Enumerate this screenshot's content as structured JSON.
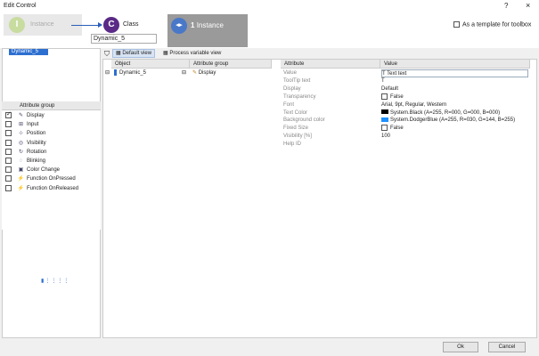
{
  "window": {
    "title": "Edit Control",
    "help": "?",
    "close": "×"
  },
  "wizard": {
    "step1_letter": "I",
    "step1_label": "Instance",
    "step2_letter": "C",
    "step2_label": "Class",
    "name_value": "Dynamic_5",
    "step3_count": "1",
    "step3_label": "Instance",
    "template_label": "As a template for toolbox"
  },
  "tree": {
    "selected": "Dynamic_5"
  },
  "attribute_groups": {
    "header": "Attribute group",
    "items": [
      {
        "label": "Display",
        "checked": true,
        "icon": "pencil-icon"
      },
      {
        "label": "Input",
        "checked": false,
        "icon": "input-icon"
      },
      {
        "label": "Position",
        "checked": false,
        "icon": "position-icon"
      },
      {
        "label": "Visibility",
        "checked": false,
        "icon": "eye-icon"
      },
      {
        "label": "Rotation",
        "checked": false,
        "icon": "rotation-icon"
      },
      {
        "label": "Blinking",
        "checked": false,
        "icon": "blink-icon"
      },
      {
        "label": "Color Change",
        "checked": false,
        "icon": "color-icon"
      },
      {
        "label": "Function OnPressed",
        "checked": false,
        "icon": "lightning-icon"
      },
      {
        "label": "Function OnReleased",
        "checked": false,
        "icon": "lightning-icon"
      }
    ]
  },
  "toolbar": {
    "default_view": "Default view",
    "process_view": "Process variable view"
  },
  "grid": {
    "col_object": "Object",
    "col_group": "Attribute group",
    "col_attribute": "Attribute",
    "col_value": "Value",
    "object": "Dynamic_5",
    "group": "Display",
    "rows": [
      {
        "attr": "Value",
        "value": "Text text"
      },
      {
        "attr": "ToolTip text",
        "value": "T"
      },
      {
        "attr": "Display",
        "value": "Default"
      },
      {
        "attr": "Transparency",
        "value": "False"
      },
      {
        "attr": "Font",
        "value": "Arial, 9pt, Regular, Western"
      },
      {
        "attr": "Text Color",
        "value": "System.Black (A=255, R=000, G=000, B=000)"
      },
      {
        "attr": "Background color",
        "value": "System.DodgerBlue (A=255, R=030, G=144, B=255)"
      },
      {
        "attr": "Fixed Size",
        "value": "False"
      },
      {
        "attr": "Visibility [%]",
        "value": "100"
      },
      {
        "attr": "Help ID",
        "value": ""
      }
    ],
    "colors": {
      "text_color": "#000000",
      "background_color": "#1e90ff"
    }
  },
  "footer": {
    "ok": "Ok",
    "cancel": "Cancel"
  }
}
